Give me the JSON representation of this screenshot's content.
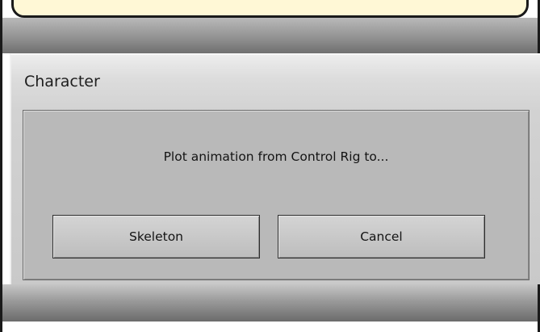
{
  "dialog": {
    "title": "Character",
    "message": "Plot animation from Control Rig to...",
    "buttons": {
      "skeleton_label": "Skeleton",
      "cancel_label": "Cancel"
    }
  },
  "colors": {
    "callout_fill": "#fff8d6",
    "panel": "#b9b9b9",
    "button_face": "#c8c8c8"
  }
}
